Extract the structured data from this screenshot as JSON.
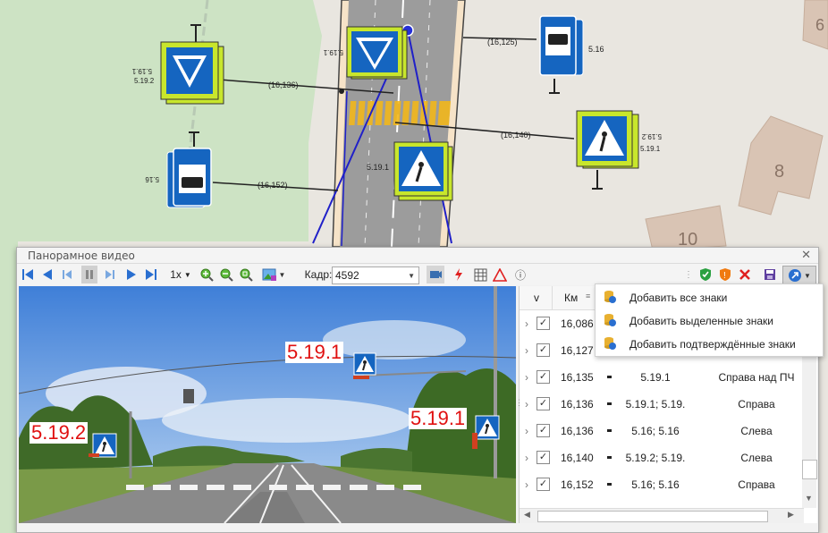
{
  "map": {
    "house_numbers": [
      "8",
      "10",
      "6"
    ],
    "signs": [
      {
        "codes": "5.19.1\n5.19.2",
        "name": "crosswalk-sign-left-top"
      },
      {
        "codes": "5.19.1",
        "name": "crosswalk-sign-road-top"
      },
      {
        "codes": "5.16",
        "name": "bus-stop-sign-right"
      },
      {
        "codes": "5.19.1",
        "name": "crosswalk-sign-road-bottom"
      },
      {
        "codes": "5.19.2\n5.19.1",
        "name": "crosswalk-sign-right"
      },
      {
        "codes": "5.16",
        "name": "bus-stop-sign-left"
      }
    ],
    "label_519_1_a": "5.19.1",
    "label_519_1_b": "5.19.1",
    "label_519_2_a": "5.19.2",
    "label_516_right": "5.16",
    "label_516_left": "5.16",
    "label_519_1_road": "5.19.1",
    "label_519_2_right": "5.19.2",
    "label_519_1_right": "5.19.1",
    "dist_1": "(16,125)",
    "dist_2": "(16,136)",
    "dist_3": "(16,140)",
    "dist_4": "(16,152)"
  },
  "window": {
    "title": "Панорамное видео",
    "close": "✕"
  },
  "toolbar": {
    "speed": "1x",
    "frame_label": "Кадр:",
    "frame_value": "4592",
    "info": "ⓘ"
  },
  "video": {
    "labels": [
      "5.19.1",
      "5.19.1",
      "5.19.2"
    ]
  },
  "list": {
    "col_v": "v",
    "col_km": "Км",
    "rows": [
      {
        "km": "16,086",
        "code": "",
        "side": ""
      },
      {
        "km": "16,127",
        "code": "",
        "side": ""
      },
      {
        "km": "16,135",
        "code": "5.19.1",
        "side": "Справа над ПЧ"
      },
      {
        "km": "16,136",
        "code": "5.19.1; 5.19.",
        "side": "Справа"
      },
      {
        "km": "16,136",
        "code": "5.16; 5.16",
        "side": "Слева"
      },
      {
        "km": "16,140",
        "code": "5.19.2; 5.19.",
        "side": "Слева"
      },
      {
        "km": "16,152",
        "code": "5.16; 5.16",
        "side": "Справа"
      }
    ]
  },
  "menu": {
    "items": [
      "Добавить все знаки",
      "Добавить выделенные знаки",
      "Добавить подтверждённые знаки"
    ]
  },
  "colors": {
    "sign_blue": "#1565c0",
    "sign_yellow": "#c8e62c",
    "label_red": "#e01010"
  }
}
